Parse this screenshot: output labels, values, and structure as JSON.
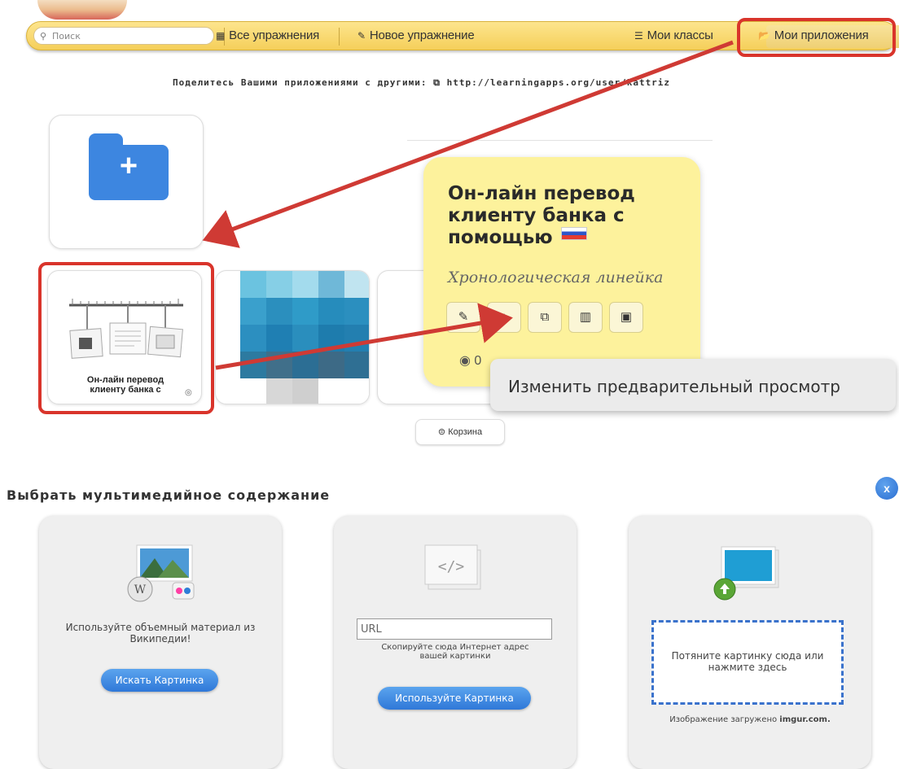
{
  "nav": {
    "search_placeholder": "Поиск",
    "all_exercises": "Все упражнения",
    "new_exercise": "Новое упражнение",
    "my_classes": "Мои классы",
    "my_apps": "Мои приложения"
  },
  "share": {
    "text": "Поделитесь Вашими приложениями с другими:",
    "url": "http://learningapps.org/user/kattriz"
  },
  "apps": [
    {
      "title_line1": "Он-лайн перевод",
      "title_line2": "клиенту банка с"
    }
  ],
  "popup": {
    "title": "Он-лайн перевод клиенту банка с помощью",
    "subtitle": "Хронологическая линейка",
    "views": "0",
    "tools": [
      "pencil-icon",
      "image-icon",
      "copy-icon",
      "stats-icon",
      "trash-icon"
    ]
  },
  "tooltip": "Изменить предварительный просмотр",
  "trash_button": "Корзина",
  "multimedia": {
    "title": "Выбрать мультимедийное содержание",
    "close": "x",
    "wiki": {
      "text": "Используйте объемный материал из Википедии!",
      "button": "Искать Картинка"
    },
    "url": {
      "placeholder": "URL",
      "hint": "Скопируйте сюда Интернет адрес вашей картинки",
      "button": "Используйте Картинка"
    },
    "upload": {
      "drop_text": "Потяните картинку сюда или нажмите здесь",
      "credit_prefix": "Изображение загружено",
      "credit_site": "imgur.com."
    }
  },
  "colors": {
    "accent_red": "#d9342b",
    "popup_yellow": "#fdf29c",
    "button_blue": "#2f78d8",
    "navbar": "#f5cf5a"
  }
}
